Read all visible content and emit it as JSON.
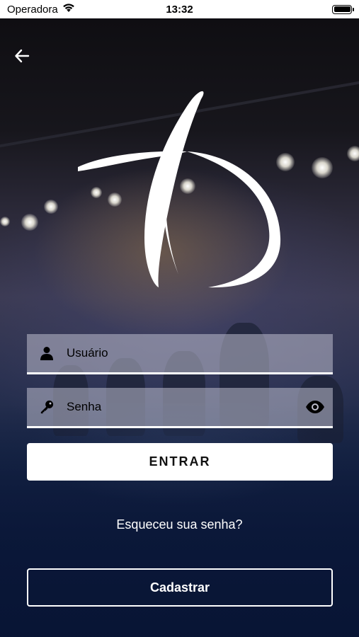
{
  "status_bar": {
    "carrier": "Operadora",
    "time": "13:32",
    "battery_level": 1.0
  },
  "header": {
    "back_icon": "arrow-left-icon"
  },
  "logo": {
    "icon": "brand-logo-icon",
    "color": "#ffffff"
  },
  "login": {
    "username": {
      "placeholder": "Usuário",
      "value": "",
      "icon": "user-icon"
    },
    "password": {
      "placeholder": "Senha",
      "value": "",
      "icon": "key-icon",
      "toggle_icon": "eye-icon"
    },
    "submit_label": "ENTRAR",
    "forgot_label": "Esqueceu sua senha?",
    "register_label": "Cadastrar"
  },
  "colors": {
    "overlay_dark": "#0a1a3a",
    "field_bg": "#bebecd",
    "button_bg": "#ffffff",
    "text_light": "#ffffff"
  }
}
